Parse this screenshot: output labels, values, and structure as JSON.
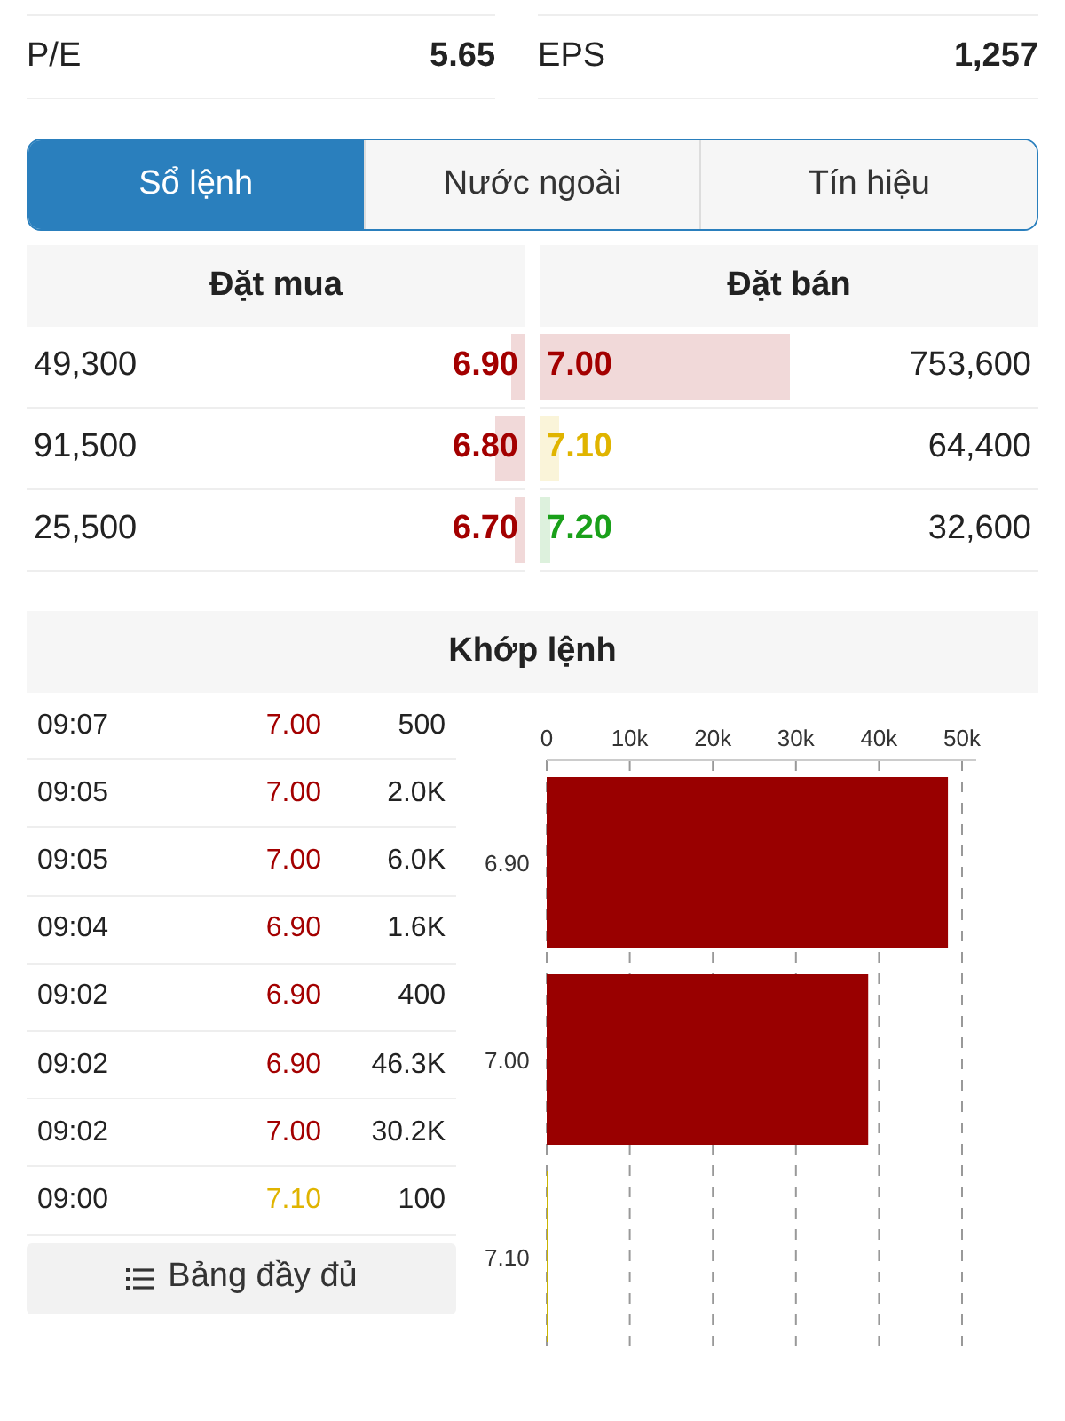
{
  "stats": [
    {
      "label": "P/E",
      "value": "5.65"
    },
    {
      "label": "EPS",
      "value": "1,257"
    }
  ],
  "tabs": [
    {
      "label": "Sổ lệnh",
      "selected": true
    },
    {
      "label": "Nước ngoài",
      "selected": false
    },
    {
      "label": "Tín hiệu",
      "selected": false
    }
  ],
  "order_book": {
    "bid_title": "Đặt mua",
    "ask_title": "Đặt bán",
    "rows": [
      {
        "bid": {
          "volume": "49,300",
          "price": "6.90",
          "color": "#a30000",
          "level": 0.03
        },
        "ask": {
          "price": "7.00",
          "color": "#a30000",
          "level": 0.5,
          "volume": "753,600"
        }
      },
      {
        "bid": {
          "volume": "91,500",
          "price": "6.80",
          "color": "#a30000",
          "level": 0.06
        },
        "ask": {
          "price": "7.10",
          "color": "#e0b400",
          "level": 0.04,
          "volume": "64,400"
        }
      },
      {
        "bid": {
          "volume": "25,500",
          "price": "6.70",
          "color": "#a30000",
          "level": 0.02
        },
        "ask": {
          "price": "7.20",
          "color": "#1aa01a",
          "level": 0.02,
          "volume": "32,600"
        }
      }
    ]
  },
  "matches": {
    "title": "Khớp lệnh",
    "trades": [
      {
        "time": "09:07",
        "price": "7.00",
        "color": "#a30000",
        "volume": "500"
      },
      {
        "time": "09:05",
        "price": "7.00",
        "color": "#a30000",
        "volume": "2.0K"
      },
      {
        "time": "09:05",
        "price": "7.00",
        "color": "#a30000",
        "volume": "6.0K"
      },
      {
        "time": "09:04",
        "price": "6.90",
        "color": "#a30000",
        "volume": "1.6K"
      },
      {
        "time": "09:02",
        "price": "6.90",
        "color": "#a30000",
        "volume": "400"
      },
      {
        "time": "09:02",
        "price": "6.90",
        "color": "#a30000",
        "volume": "46.3K"
      },
      {
        "time": "09:02",
        "price": "7.00",
        "color": "#a30000",
        "volume": "30.2K"
      },
      {
        "time": "09:00",
        "price": "7.10",
        "color": "#e0b400",
        "volume": "100"
      }
    ],
    "full_table_button": "Bảng đầy đủ",
    "chart_data": {
      "type": "bar",
      "orientation": "horizontal",
      "grid": true,
      "categories": [
        "6.90",
        "7.00",
        "7.10"
      ],
      "values": [
        48300,
        38700,
        100
      ],
      "xlim": [
        0,
        50000
      ],
      "xticks": [
        {
          "value": 0,
          "label": "0"
        },
        {
          "value": 10000,
          "label": "10k"
        },
        {
          "value": 20000,
          "label": "20k"
        },
        {
          "value": 30000,
          "label": "30k"
        },
        {
          "value": 40000,
          "label": "40k"
        },
        {
          "value": 50000,
          "label": "50k"
        }
      ]
    }
  }
}
